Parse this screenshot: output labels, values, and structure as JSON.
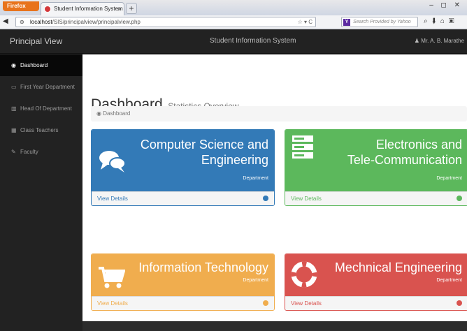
{
  "browser": {
    "firefox_label": "Firefox",
    "tab_title": "Student Information System",
    "tab_close": "×",
    "new_tab": "+",
    "url_host": "localhost",
    "url_path": "/SIS/principalview/principalview.php",
    "search_placeholder": "Search Provided by Yahoo",
    "window_controls": "– ◻ ✕"
  },
  "topbar": {
    "brand": "Principal View",
    "title": "Student Information System",
    "user": "Mr. A. B. Marathe"
  },
  "sidebar": {
    "items": [
      {
        "label": "Dashboard",
        "icon": "dashboard-icon",
        "glyph": "◉"
      },
      {
        "label": "First Year Department",
        "icon": "monitor-icon",
        "glyph": "▭"
      },
      {
        "label": "Head Of Department",
        "icon": "bar-chart-icon",
        "glyph": "▥"
      },
      {
        "label": "Class Teachers",
        "icon": "table-icon",
        "glyph": "▦"
      },
      {
        "label": "Faculty",
        "icon": "edit-icon",
        "glyph": "✎"
      }
    ]
  },
  "page": {
    "title": "Dashboard",
    "subtitle": "Statistics Overview",
    "breadcrumb": "Dashboard"
  },
  "panels": [
    {
      "name_line1": "Computer Science and",
      "name_line2": "Engineering",
      "sub": "Department",
      "link": "View Details",
      "color": "#337ab7",
      "icon": "comments-icon"
    },
    {
      "name_line1": "Electronics and",
      "name_line2": "Tele-Communication",
      "sub": "Department",
      "link": "View Details",
      "color": "#5cb85c",
      "icon": "server-icon"
    },
    {
      "name_line1": "Information Technology",
      "name_line2": "",
      "sub": "Department",
      "link": "View Details",
      "color": "#f0ad4e",
      "icon": "shopping-cart-icon"
    },
    {
      "name_line1": "Mechnical Engineering",
      "name_line2": "",
      "sub": "Department",
      "link": "View Details",
      "color": "#d9534f",
      "icon": "life-ring-icon"
    }
  ]
}
